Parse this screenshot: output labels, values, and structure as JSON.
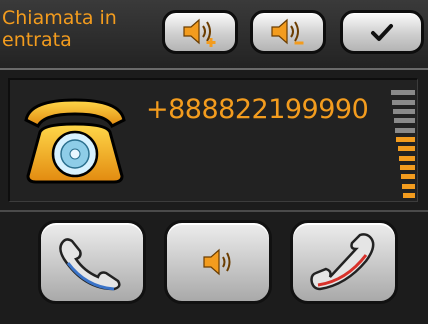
{
  "header": {
    "title": "Chiamata in entrata",
    "buttons": [
      {
        "icon": "volume-up-icon"
      },
      {
        "icon": "volume-down-icon"
      },
      {
        "icon": "checkmark-icon"
      }
    ]
  },
  "call": {
    "number": "+888822199990",
    "caller_icon": "telephone-icon",
    "signal": {
      "total_bars": 12,
      "active_bars": 7,
      "active_color": "#f39c1e",
      "inactive_color": "#8a8a8a"
    }
  },
  "actions": [
    {
      "icon": "answer-call-icon"
    },
    {
      "icon": "speaker-icon"
    },
    {
      "icon": "hang-up-icon"
    }
  ],
  "colors": {
    "accent": "#f39c1e"
  }
}
